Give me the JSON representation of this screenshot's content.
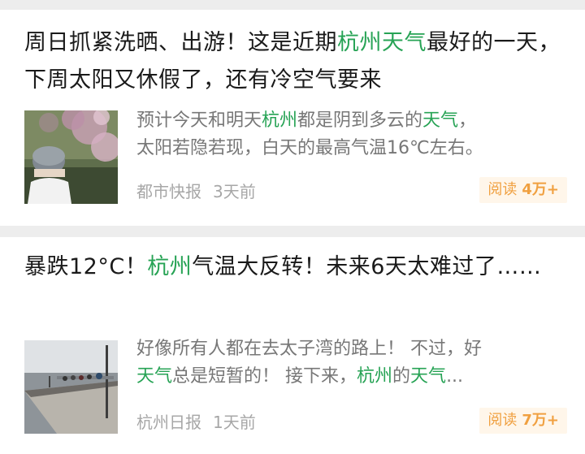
{
  "articles": [
    {
      "title": [
        {
          "t": "周日抓紧洗晒、出游！这是近期",
          "hl": false
        },
        {
          "t": "杭州天气",
          "hl": true
        },
        {
          "t": "最好的一天，下周太阳又休假了，还有冷空气要来",
          "hl": false
        }
      ],
      "snippet_line1": [
        {
          "t": "预计今天和明天",
          "hl": false
        },
        {
          "t": "杭州",
          "hl": true
        },
        {
          "t": "都是阴到多云的",
          "hl": false
        },
        {
          "t": "天气",
          "hl": true
        },
        {
          "t": "，",
          "hl": false
        }
      ],
      "snippet_line2": [
        {
          "t": "太阳若隐若现，白天的最高气温16℃左右。",
          "hl": false
        }
      ],
      "source": "都市快报",
      "time": "3天前",
      "reads_label": "阅读",
      "reads_count": "4万+",
      "thumb_icon": "blossom-photo"
    },
    {
      "title": [
        {
          "t": "暴跌12°C！",
          "hl": false
        },
        {
          "t": "杭州",
          "hl": true
        },
        {
          "t": "气温大反转！未来6天太难过了……",
          "hl": false
        }
      ],
      "snippet_line1": [
        {
          "t": "好像所有人都在去太子湾的路上！ 不过，好",
          "hl": false
        }
      ],
      "snippet_line2": [
        {
          "t": "天气",
          "hl": true
        },
        {
          "t": "总是短暂的！ 接下来，",
          "hl": false
        },
        {
          "t": "杭州",
          "hl": true
        },
        {
          "t": "的",
          "hl": false
        },
        {
          "t": "天气",
          "hl": true
        },
        {
          "t": "...",
          "hl": false
        }
      ],
      "source": "杭州日报",
      "time": "1天前",
      "reads_label": "阅读",
      "reads_count": "7万+",
      "thumb_icon": "lake-causeway-photo"
    }
  ],
  "colors": {
    "highlight": "#27a355",
    "badge_text": "#f0a040",
    "badge_bg": "#fff6ea"
  }
}
